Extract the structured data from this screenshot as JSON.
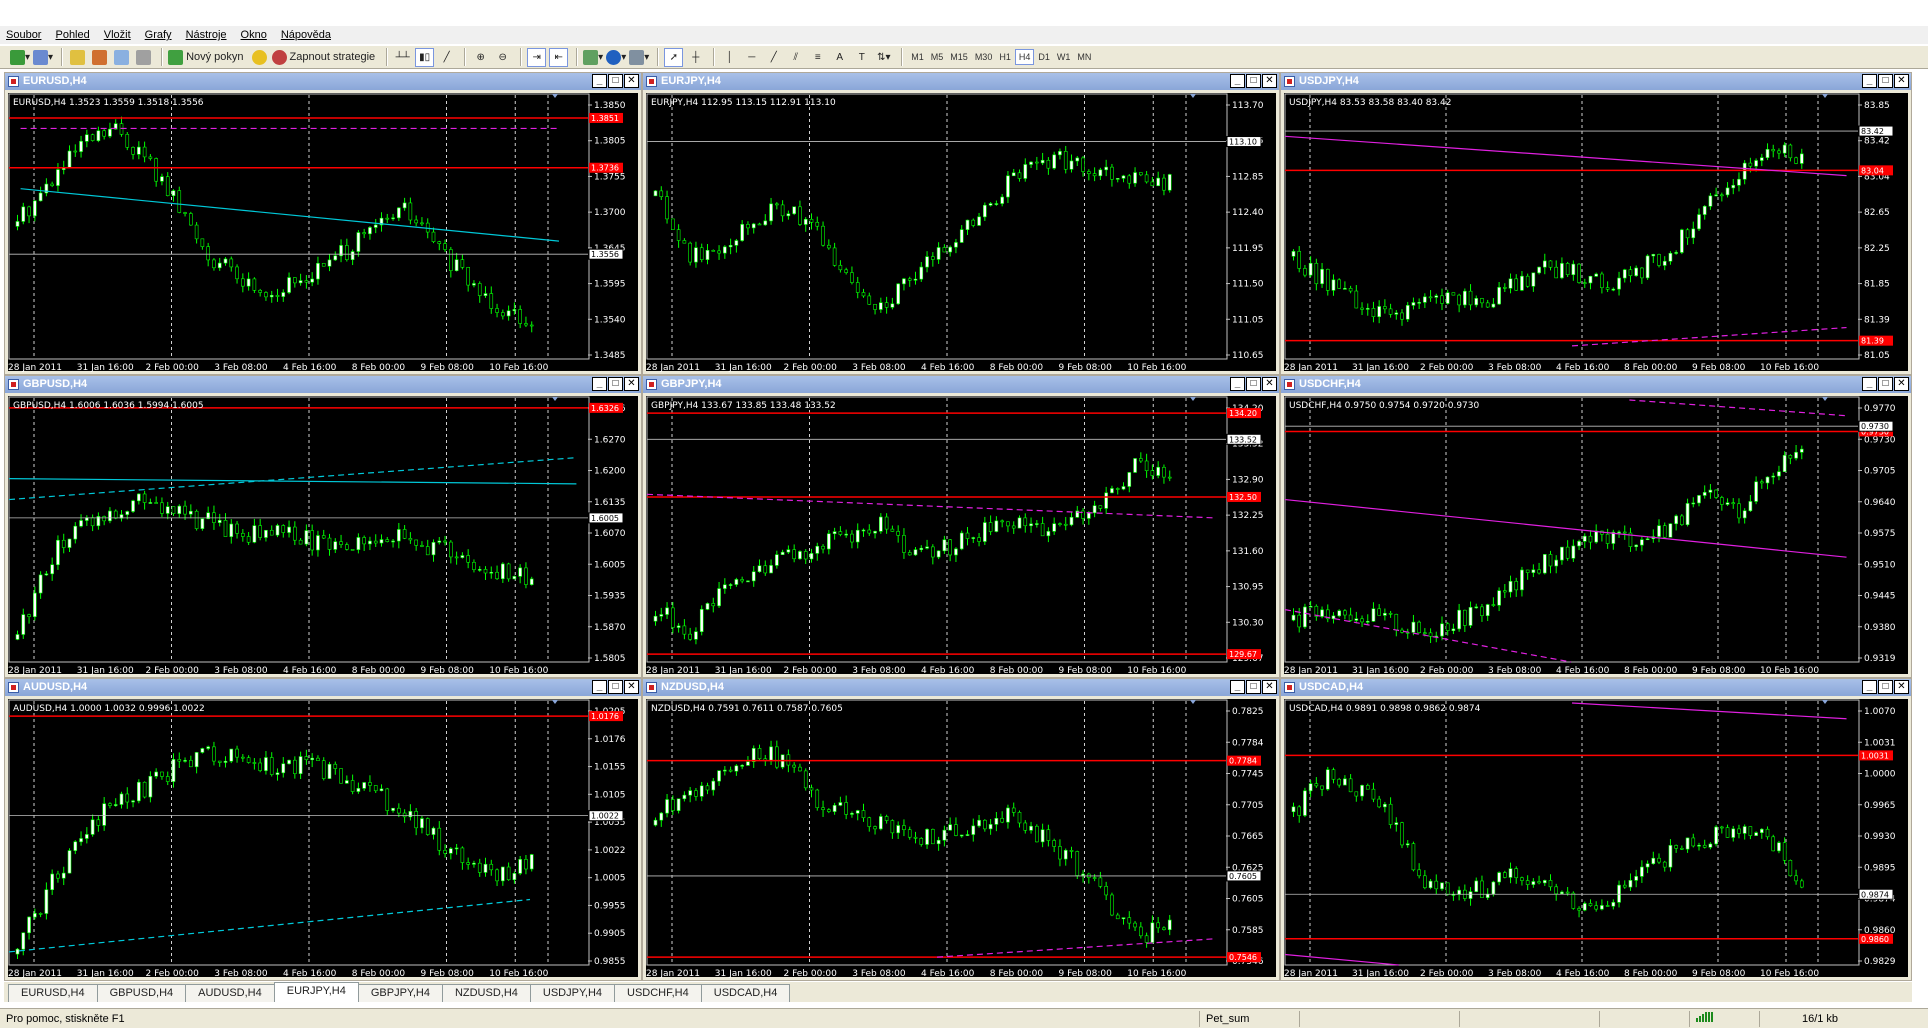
{
  "menu": [
    "Soubor",
    "Pohled",
    "Vložit",
    "Grafy",
    "Nástroje",
    "Okno",
    "Nápověda"
  ],
  "toolbar": {
    "new_order": "Nový pokyn",
    "strategies": "Zapnout strategie",
    "timeframes": [
      "M1",
      "M5",
      "M15",
      "M30",
      "H1",
      "H4",
      "D1",
      "W1",
      "MN"
    ],
    "active_timeframe": "H4"
  },
  "charts": [
    {
      "title": "EURUSD,H4",
      "info": "EURUSD,H4  1.3523 1.3559 1.3518 1.3556",
      "ylabels": [
        "1.3850",
        "1.3805",
        "1.3755",
        "1.3700",
        "1.3645",
        "1.3595",
        "1.3540",
        "1.3485"
      ],
      "price": "1.3556",
      "levels": [
        "1.3851",
        "1.3736"
      ]
    },
    {
      "title": "EURJPY,H4",
      "info": "EURJPY,H4  112.95 113.15 112.91 113.10",
      "ylabels": [
        "113.70",
        "113.25",
        "112.85",
        "112.40",
        "111.95",
        "111.50",
        "111.05",
        "110.65"
      ],
      "price": "113.10",
      "levels": []
    },
    {
      "title": "USDJPY,H4",
      "info": "USDJPY,H4  83.53 83.58 83.40 83.42",
      "ylabels": [
        "83.85",
        "83.42",
        "83.04",
        "82.65",
        "82.25",
        "81.85",
        "81.39",
        "81.05"
      ],
      "price": "83.42",
      "levels": [
        "83.04",
        "81.39"
      ]
    },
    {
      "title": "GBPUSD,H4",
      "info": "GBPUSD,H4  1.6006 1.6036 1.5994 1.6005",
      "ylabels": [
        "1.6326",
        "1.6270",
        "1.6200",
        "1.6135",
        "1.6070",
        "1.6005",
        "1.5935",
        "1.5870",
        "1.5805"
      ],
      "price": "1.6005",
      "levels": [
        "1.6326"
      ]
    },
    {
      "title": "GBPJPY,H4",
      "info": "GBPJPY,H4  133.67 133.85 133.48 133.52",
      "ylabels": [
        "134.20",
        "133.52",
        "132.90",
        "132.25",
        "131.60",
        "130.95",
        "130.30",
        "129.67"
      ],
      "price": "133.52",
      "levels": [
        "134.20",
        "132.50",
        "129.67"
      ]
    },
    {
      "title": "USDCHF,H4",
      "info": "USDCHF,H4  0.9750 0.9754 0.9720 0.9730",
      "ylabels": [
        "0.9770",
        "0.9730",
        "0.9705",
        "0.9640",
        "0.9575",
        "0.9510",
        "0.9445",
        "0.9380",
        "0.9319"
      ],
      "price": "0.9730",
      "levels": [
        "0.9730"
      ]
    },
    {
      "title": "AUDUSD,H4",
      "info": "AUDUSD,H4  1.0000 1.0032 0.9996 1.0022",
      "ylabels": [
        "1.0205",
        "1.0176",
        "1.0155",
        "1.0105",
        "1.0055",
        "1.0022",
        "1.0005",
        "0.9955",
        "0.9905",
        "0.9855"
      ],
      "price": "1.0022",
      "levels": [
        "1.0176"
      ]
    },
    {
      "title": "NZDUSD,H4",
      "info": "NZDUSD,H4  0.7591 0.7611 0.7587 0.7605",
      "ylabels": [
        "0.7825",
        "0.7784",
        "0.7745",
        "0.7705",
        "0.7665",
        "0.7625",
        "0.7605",
        "0.7585",
        "0.7546"
      ],
      "price": "0.7605",
      "levels": [
        "0.7784",
        "0.7546"
      ]
    },
    {
      "title": "USDCAD,H4",
      "info": "USDCAD,H4  0.9891 0.9898 0.9862 0.9874",
      "ylabels": [
        "1.0070",
        "1.0031",
        "1.0000",
        "0.9965",
        "0.9930",
        "0.9895",
        "0.9874",
        "0.9860",
        "0.9829"
      ],
      "price": "0.9874",
      "levels": [
        "1.0031",
        "0.9860"
      ]
    }
  ],
  "xlabels": [
    "28 Jan 2011",
    "31 Jan 16:00",
    "2 Feb 00:00",
    "3 Feb 08:00",
    "4 Feb 16:00",
    "8 Feb 00:00",
    "9 Feb 08:00",
    "10 Feb 16:00"
  ],
  "tabs": [
    "EURUSD,H4",
    "GBPUSD,H4",
    "AUDUSD,H4",
    "EURJPY,H4",
    "GBPJPY,H4",
    "NZDUSD,H4",
    "USDJPY,H4",
    "USDCHF,H4",
    "USDCAD,H4"
  ],
  "active_tab": "EURJPY,H4",
  "status": {
    "help": "Pro pomoc, stiskněte F1",
    "profile": "Pet_sum",
    "traffic": "16/1 kb"
  },
  "colors": {
    "bull": "#ffffff",
    "bear": "#000000",
    "wick": "#00ff00",
    "support": "#ff0000",
    "trend_cyan": "#00c8d8",
    "trend_magenta": "#e020e0"
  }
}
